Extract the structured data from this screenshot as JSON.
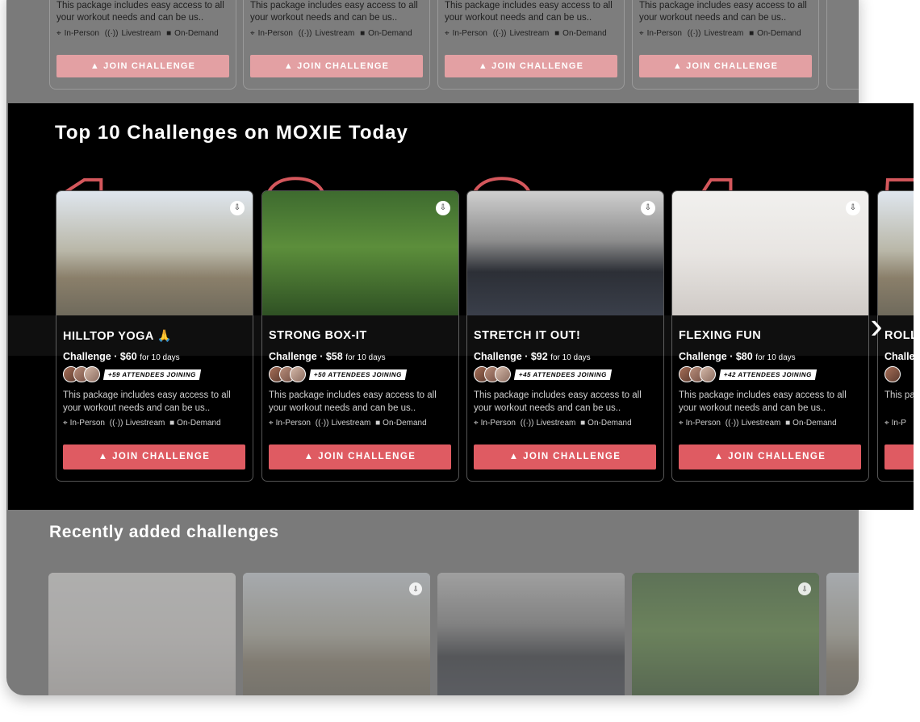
{
  "background": {
    "top_row_cards": [
      {
        "desc": "This package includes easy access to all your workout needs and can be us..",
        "meta": [
          "In-Person",
          "Livestream",
          "On-Demand"
        ],
        "button": "JOIN CHALLENGE"
      },
      {
        "desc": "This package includes easy access to all your workout needs and can be us..",
        "meta": [
          "In-Person",
          "Livestream",
          "On-Demand"
        ],
        "button": "JOIN CHALLENGE"
      },
      {
        "desc": "This package includes easy access to all your workout needs and can be us..",
        "meta": [
          "In-Person",
          "Livestream",
          "On-Demand"
        ],
        "button": "JOIN CHALLENGE"
      },
      {
        "desc": "This package includes easy access to all your workout needs and can be us..",
        "meta": [
          "In-Person",
          "Livestream",
          "On-Demand"
        ],
        "button": "JOIN CHALLENGE"
      }
    ],
    "recent_title": "Recently added challenges"
  },
  "panel": {
    "title": "Top 10 Challenges on MOXIE Today",
    "cards": [
      {
        "rank": "1",
        "title": "HILLTOP YOGA 🙏",
        "price_label": "Challenge · $60",
        "duration": "for 10 days",
        "attendees": "+59 ATTENDEES JOINING",
        "desc": "This package includes easy access to all your workout needs and can be us..",
        "meta": [
          "In-Person",
          "Livestream",
          "On-Demand"
        ],
        "button": "JOIN CHALLENGE"
      },
      {
        "rank": "2",
        "title": "STRONG BOX-IT",
        "price_label": "Challenge · $58",
        "duration": "for 10 days",
        "attendees": "+50 ATTENDEES JOINING",
        "desc": "This package includes easy access to all your workout needs and can be us..",
        "meta": [
          "In-Person",
          "Livestream",
          "On-Demand"
        ],
        "button": "JOIN CHALLENGE"
      },
      {
        "rank": "3",
        "title": "STRETCH IT OUT!",
        "price_label": "Challenge · $92",
        "duration": "for 10 days",
        "attendees": "+45 ATTENDEES JOINING",
        "desc": "This package includes easy access to all your workout needs and can be us..",
        "meta": [
          "In-Person",
          "Livestream",
          "On-Demand"
        ],
        "button": "JOIN CHALLENGE"
      },
      {
        "rank": "4",
        "title": "FLEXING FUN",
        "price_label": "Challenge · $80",
        "duration": "for 10 days",
        "attendees": "+42 ATTENDEES JOINING",
        "desc": "This package includes easy access to all your workout needs and can be us..",
        "meta": [
          "In-Person",
          "Livestream",
          "On-Demand"
        ],
        "button": "JOIN CHALLENGE"
      },
      {
        "rank": "5",
        "title": "ROLL",
        "price_label": "Challe",
        "duration": "",
        "attendees": "",
        "desc": "This pa all you",
        "meta": [
          "In-P"
        ],
        "button": ""
      }
    ]
  },
  "icons": {
    "download": "download-icon",
    "location": "location-icon",
    "livestream": "livestream-icon",
    "video": "video-icon",
    "mountain": "mountain-icon",
    "next": "chevron-right-icon"
  },
  "colors": {
    "accent": "#df5b62",
    "panel": "#000000",
    "muted": "#7a7a7a"
  }
}
